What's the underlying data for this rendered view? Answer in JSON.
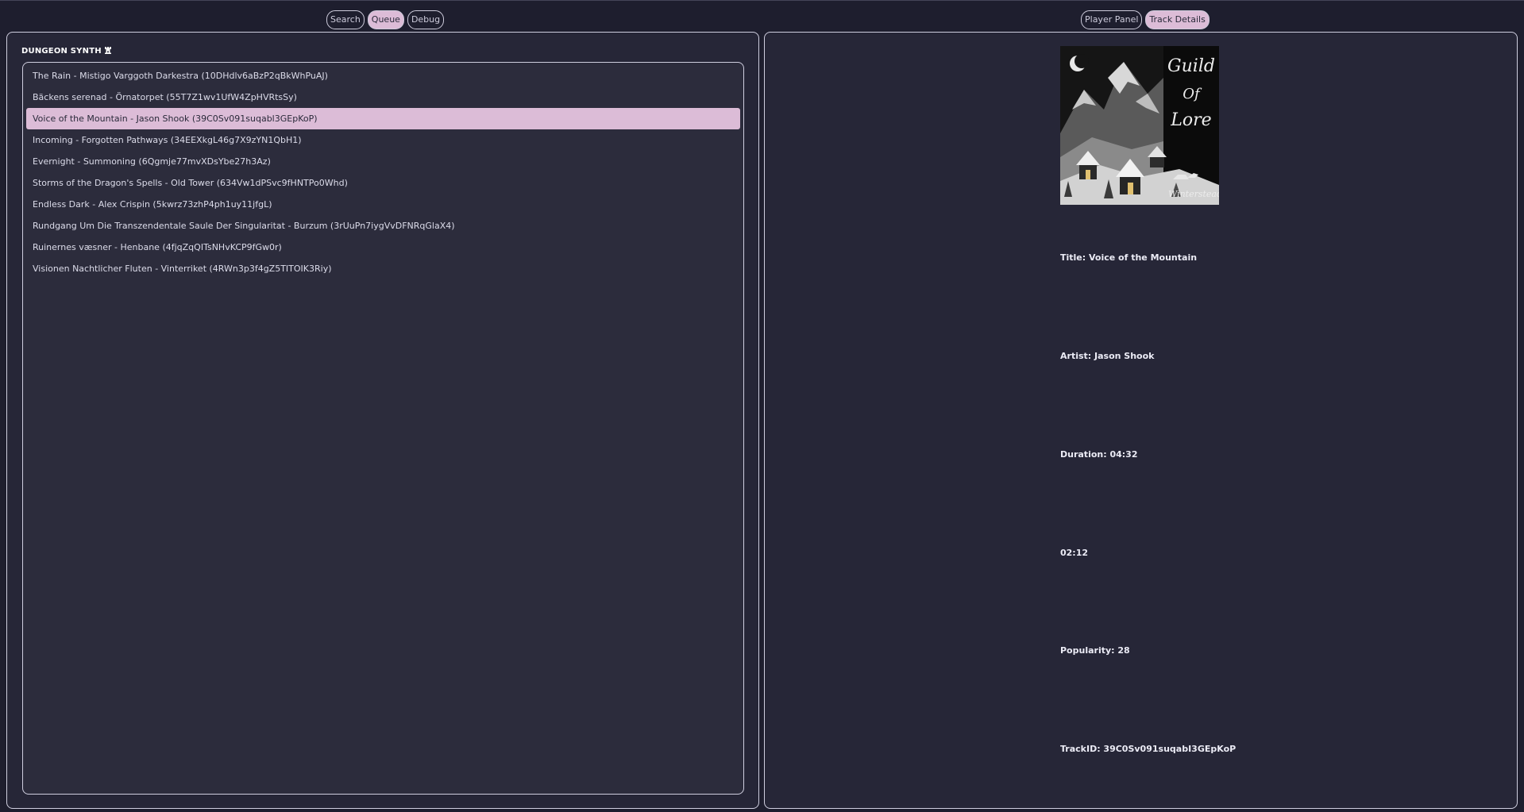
{
  "left_tabs": [
    {
      "label": "Search",
      "active": false
    },
    {
      "label": "Queue",
      "active": true
    },
    {
      "label": "Debug",
      "active": false
    }
  ],
  "right_tabs": [
    {
      "label": "Player Panel",
      "active": false
    },
    {
      "label": "Track Details",
      "active": true
    }
  ],
  "queue": {
    "title": "DUNGEON SYNTH",
    "title_icon": "castle-icon",
    "selected_index": 2,
    "items": [
      "The Rain - Mistigo Varggoth Darkestra (10DHdlv6aBzP2qBkWhPuAJ)",
      "Bäckens serenad - Örnatorpet (55T7Z1wv1UfW4ZpHVRtsSy)",
      "Voice of the Mountain - Jason Shook (39C0Sv091suqabl3GEpKoP)",
      "Incoming - Forgotten Pathways (34EEXkgL46g7X9zYN1QbH1)",
      "Evernight - Summoning (6Qgmje77mvXDsYbe27h3Az)",
      "Storms of the Dragon's Spells - Old Tower (634Vw1dPSvc9fHNTPo0Whd)",
      "Endless Dark - Alex Crispin (5kwrz73zhP4ph1uy11jfgL)",
      "Rundgang Um Die Transzendentale Saule Der Singularitat - Burzum (3rUuPn7iygVvDFNRqGlaX4)",
      "Ruinernes væsner - Henbane (4fjqZqQITsNHvKCP9fGw0r)",
      "Visionen Nachtlicher Fluten - Vinterriket (4RWn3p3f4gZ5TITOIK3Riy)"
    ]
  },
  "track_details": {
    "cover_text": [
      "Guild",
      "Of",
      "Lore",
      "Winterstead"
    ],
    "title": "Title: Voice of the Mountain",
    "artist": "Artist: Jason Shook",
    "duration": "Duration: 04:32",
    "position": "02:12",
    "popularity": "Popularity: 28",
    "track_id": "TrackID: 39C0Sv091suqabI3GEpKoP"
  },
  "colors": {
    "background": "#1e1e2e",
    "panel": "#262637",
    "list": "#2c2c3c",
    "accent": "#dcbcd7",
    "border": "#cfcedf"
  }
}
